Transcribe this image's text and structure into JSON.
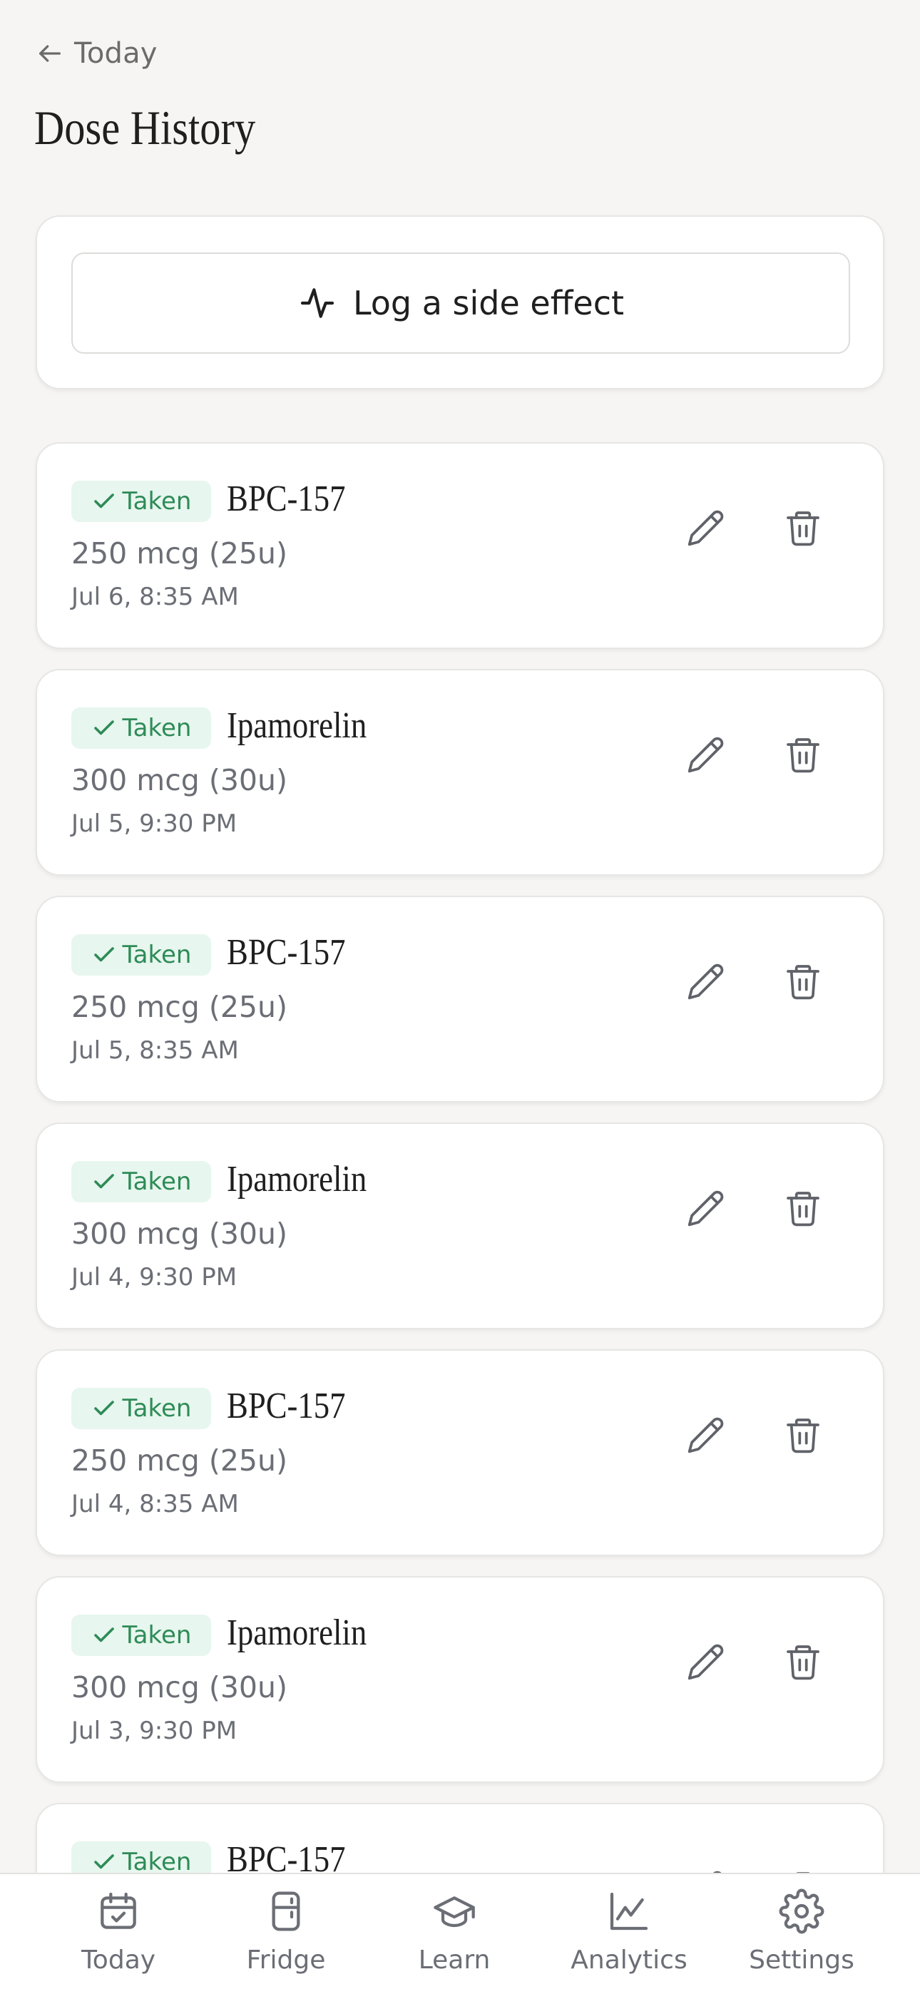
{
  "header": {
    "back_label": "Today",
    "title": "Dose History"
  },
  "side_effect": {
    "button_label": "Log a side effect"
  },
  "doses": [
    {
      "status": "Taken",
      "peptide": "BPC-157",
      "amount": "250 mcg (25u)",
      "when": "Jul 6, 8:35 AM"
    },
    {
      "status": "Taken",
      "peptide": "Ipamorelin",
      "amount": "300 mcg (30u)",
      "when": "Jul 5, 9:30 PM"
    },
    {
      "status": "Taken",
      "peptide": "BPC-157",
      "amount": "250 mcg (25u)",
      "when": "Jul 5, 8:35 AM"
    },
    {
      "status": "Taken",
      "peptide": "Ipamorelin",
      "amount": "300 mcg (30u)",
      "when": "Jul 4, 9:30 PM"
    },
    {
      "status": "Taken",
      "peptide": "BPC-157",
      "amount": "250 mcg (25u)",
      "when": "Jul 4, 8:35 AM"
    },
    {
      "status": "Taken",
      "peptide": "Ipamorelin",
      "amount": "300 mcg (30u)",
      "when": "Jul 3, 9:30 PM"
    },
    {
      "status": "Taken",
      "peptide": "BPC-157"
    }
  ],
  "tabs": [
    {
      "label": "Today",
      "icon": "calendar-check-icon"
    },
    {
      "label": "Fridge",
      "icon": "fridge-icon"
    },
    {
      "label": "Learn",
      "icon": "graduation-cap-icon"
    },
    {
      "label": "Analytics",
      "icon": "line-chart-icon"
    },
    {
      "label": "Settings",
      "icon": "gear-icon"
    }
  ],
  "colors": {
    "background": "#f6f5f3",
    "card": "#ffffff",
    "taken_badge_bg": "#e7f6ee",
    "taken_badge_text": "#2e8b57",
    "muted_text": "#6b6e75"
  }
}
